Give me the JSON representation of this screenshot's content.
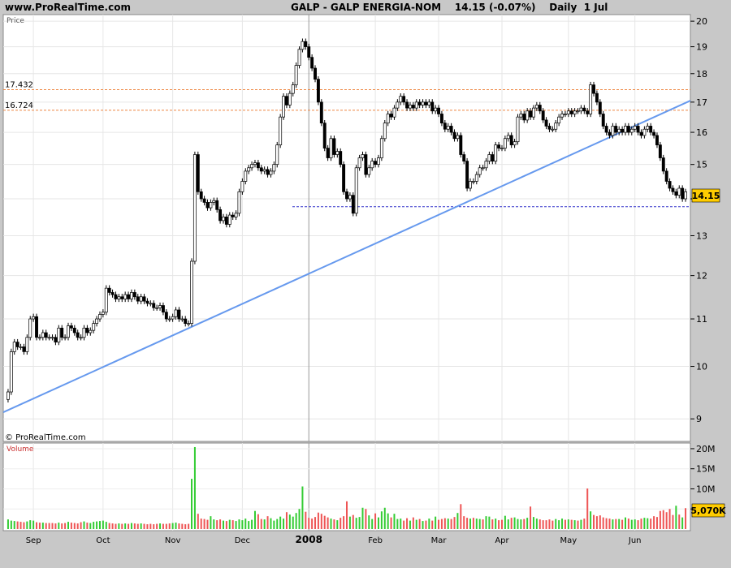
{
  "header": {
    "site": "www.ProRealTime.com",
    "title": "GALP - GALP ENERGIA-NOM    14.15 (-0.07%)    Daily  1 Jul"
  },
  "price_panel": {
    "label": "Price",
    "copyright": "© ProRealTime.com",
    "last_price_badge": "14.15"
  },
  "volume_panel": {
    "label": "Volume",
    "last_volume_badge": "5,070K"
  },
  "colors": {
    "background": "#c8c8c8",
    "panel": "#ffffff",
    "up_volume": "#33cc33",
    "down_volume": "#ee5555",
    "trendline": "#6699ee",
    "resistance": "#ee8844",
    "support": "#3333cc",
    "badge": "#ffcc00"
  },
  "chart_data": [
    {
      "type": "line",
      "title": "GALP - GALP ENERGIA-NOM",
      "ylabel": "Price",
      "ylim": [
        8.8,
        20.2
      ],
      "y_ticks": [
        9,
        10,
        11,
        12,
        13,
        14,
        15,
        16,
        17,
        18,
        19,
        20
      ],
      "x_ticks": [
        "Sep",
        "Oct",
        "Nov",
        "Dec",
        "2008",
        "Feb",
        "Mar",
        "Apr",
        "May",
        "Jun"
      ],
      "x_tick_index": [
        8,
        30,
        52,
        74,
        95,
        116,
        136,
        156,
        177,
        198
      ],
      "log_scale": true,
      "grid": true,
      "points": 215,
      "closes": [
        9.5,
        10.3,
        10.5,
        10.4,
        10.4,
        10.3,
        10.6,
        11.0,
        11.05,
        10.6,
        10.6,
        10.7,
        10.6,
        10.6,
        10.6,
        10.5,
        10.8,
        10.6,
        10.6,
        10.85,
        10.8,
        10.7,
        10.6,
        10.6,
        10.8,
        10.7,
        10.75,
        10.9,
        11.0,
        11.1,
        11.15,
        11.7,
        11.6,
        11.55,
        11.45,
        11.5,
        11.45,
        11.55,
        11.45,
        11.6,
        11.5,
        11.4,
        11.5,
        11.4,
        11.35,
        11.35,
        11.25,
        11.25,
        11.3,
        11.15,
        11.0,
        11.0,
        11.05,
        11.2,
        11.0,
        11.0,
        10.9,
        10.9,
        12.35,
        15.3,
        14.2,
        14.0,
        13.9,
        13.75,
        13.9,
        13.95,
        13.7,
        13.4,
        13.5,
        13.3,
        13.55,
        13.5,
        13.6,
        14.2,
        14.5,
        14.8,
        14.9,
        15.0,
        15.05,
        14.9,
        14.8,
        14.85,
        14.7,
        14.8,
        15.0,
        15.6,
        16.5,
        17.2,
        16.9,
        17.3,
        17.6,
        18.3,
        18.9,
        19.2,
        19.0,
        18.6,
        18.2,
        17.8,
        17.0,
        16.3,
        15.5,
        15.2,
        15.8,
        15.3,
        15.4,
        15.0,
        14.2,
        14.0,
        14.1,
        13.6,
        14.9,
        15.2,
        15.3,
        14.7,
        14.9,
        15.1,
        15.0,
        15.2,
        15.8,
        16.3,
        16.6,
        16.5,
        16.8,
        17.0,
        17.2,
        17.0,
        16.8,
        16.9,
        16.8,
        17.0,
        16.9,
        17.0,
        16.9,
        17.0,
        16.7,
        16.8,
        16.6,
        16.3,
        16.1,
        16.2,
        16.0,
        15.8,
        15.9,
        15.3,
        15.1,
        14.3,
        14.5,
        14.5,
        14.7,
        14.9,
        14.9,
        15.1,
        15.3,
        15.1,
        15.6,
        15.5,
        15.5,
        15.8,
        15.9,
        15.6,
        15.7,
        16.5,
        16.6,
        16.4,
        16.7,
        16.5,
        16.8,
        16.9,
        16.7,
        16.4,
        16.2,
        16.1,
        16.1,
        16.3,
        16.5,
        16.6,
        16.6,
        16.7,
        16.6,
        16.7,
        16.7,
        16.8,
        16.7,
        16.6,
        17.6,
        17.3,
        17.0,
        16.6,
        16.2,
        16.0,
        15.9,
        16.2,
        16.0,
        16.1,
        16.0,
        16.2,
        16.0,
        16.1,
        16.2,
        16.0,
        15.9,
        16.1,
        16.2,
        16.0,
        15.9,
        15.6,
        15.2,
        14.8,
        14.5,
        14.3,
        14.2,
        14.1,
        14.3,
        14.0,
        14.2
      ],
      "annotations": {
        "resistance_levels": [
          17.432,
          16.724
        ],
        "support_level": 13.78,
        "trendline": {
          "from_index": 0,
          "from_value": 9.12,
          "to_index": 215,
          "to_value": 17.05
        }
      }
    },
    {
      "type": "bar",
      "title": "Volume",
      "ylabel": "Volume",
      "ylim": [
        0,
        21000000
      ],
      "y_ticks": [
        "5M",
        "10M",
        "15M",
        "20M"
      ],
      "y_tick_values": [
        5000000,
        10000000,
        15000000,
        20000000
      ],
      "volumes_m": [
        2.4,
        2.1,
        2.0,
        1.9,
        1.8,
        1.7,
        1.9,
        2.2,
        2.1,
        1.7,
        1.6,
        1.6,
        1.5,
        1.5,
        1.5,
        1.4,
        1.6,
        1.4,
        1.5,
        1.8,
        1.6,
        1.5,
        1.4,
        1.7,
        1.9,
        1.6,
        1.5,
        1.8,
        1.9,
        2.0,
        2.1,
        1.8,
        1.5,
        1.4,
        1.3,
        1.4,
        1.3,
        1.4,
        1.3,
        1.5,
        1.4,
        1.3,
        1.4,
        1.3,
        1.2,
        1.3,
        1.2,
        1.3,
        1.4,
        1.3,
        1.3,
        1.4,
        1.5,
        1.6,
        1.4,
        1.3,
        1.2,
        1.3,
        12.5,
        20.4,
        3.8,
        2.6,
        2.5,
        2.3,
        3.2,
        2.4,
        2.2,
        2.4,
        2.1,
        2.0,
        2.3,
        2.2,
        2.0,
        2.4,
        2.2,
        2.6,
        2.0,
        2.3,
        4.5,
        3.7,
        2.5,
        2.4,
        3.2,
        2.7,
        2.1,
        2.5,
        3.1,
        2.6,
        4.2,
        3.6,
        3.1,
        4.0,
        5.0,
        10.6,
        4.3,
        2.8,
        2.6,
        3.0,
        4.1,
        3.8,
        3.3,
        2.9,
        2.6,
        2.4,
        2.2,
        2.8,
        3.2,
        6.9,
        3.1,
        3.5,
        2.8,
        3.0,
        5.3,
        5.0,
        3.4,
        2.5,
        3.9,
        2.9,
        4.4,
        5.3,
        3.9,
        2.9,
        3.8,
        2.5,
        2.6,
        2.1,
        2.7,
        2.1,
        2.9,
        2.3,
        2.5,
        2.0,
        2.1,
        2.6,
        2.1,
        3.1,
        2.3,
        2.5,
        2.7,
        2.6,
        2.5,
        3.0,
        4.0,
        6.2,
        3.2,
        2.8,
        2.6,
        2.8,
        2.6,
        2.5,
        2.4,
        3.2,
        3.1,
        2.4,
        2.6,
        2.2,
        2.3,
        3.3,
        2.4,
        2.8,
        2.9,
        2.5,
        2.4,
        2.5,
        2.8,
        5.6,
        3.0,
        2.6,
        2.4,
        2.2,
        2.2,
        2.4,
        2.1,
        2.5,
        2.2,
        2.6,
        2.3,
        2.4,
        2.3,
        2.2,
        2.1,
        2.3,
        2.6,
        10.1,
        4.4,
        3.5,
        3.2,
        3.4,
        2.9,
        2.7,
        2.6,
        2.4,
        2.5,
        2.5,
        2.3,
        2.9,
        2.6,
        2.3,
        2.4,
        2.2,
        2.6,
        2.8,
        2.7,
        2.6,
        3.2,
        3.0,
        4.5,
        4.7,
        4.2,
        5.0,
        3.5,
        5.8,
        3.6,
        2.9,
        5.2
      ],
      "up_flags": [
        1,
        1,
        1,
        0,
        0,
        0,
        1,
        1,
        1,
        0,
        0,
        1,
        0,
        0,
        0,
        0,
        1,
        0,
        0,
        1,
        0,
        0,
        0,
        0,
        1,
        0,
        1,
        1,
        1,
        1,
        1,
        1,
        0,
        0,
        0,
        1,
        0,
        1,
        0,
        1,
        0,
        0,
        1,
        0,
        0,
        0,
        0,
        0,
        1,
        0,
        0,
        0,
        1,
        1,
        0,
        0,
        0,
        0,
        1,
        1,
        0,
        0,
        0,
        0,
        1,
        1,
        0,
        0,
        1,
        0,
        1,
        0,
        1,
        1,
        1,
        1,
        1,
        1,
        1,
        0,
        0,
        1,
        0,
        1,
        1,
        1,
        1,
        1,
        0,
        1,
        1,
        1,
        1,
        1,
        0,
        0,
        0,
        0,
        0,
        0,
        0,
        0,
        1,
        0,
        1,
        0,
        0,
        0,
        1,
        0,
        1,
        1,
        1,
        0,
        1,
        1,
        0,
        1,
        1,
        1,
        1,
        0,
        1,
        1,
        1,
        0,
        0,
        1,
        0,
        1,
        0,
        1,
        0,
        1,
        0,
        1,
        0,
        0,
        0,
        1,
        0,
        0,
        1,
        0,
        0,
        0,
        1,
        0,
        1,
        1,
        0,
        1,
        1,
        0,
        1,
        0,
        0,
        1,
        1,
        0,
        1,
        1,
        1,
        0,
        1,
        0,
        1,
        1,
        0,
        0,
        0,
        0,
        0,
        1,
        1,
        1,
        0,
        1,
        0,
        1,
        0,
        1,
        0,
        0,
        1,
        0,
        0,
        0,
        0,
        0,
        0,
        1,
        0,
        1,
        0,
        1,
        0,
        1,
        1,
        0,
        0,
        1,
        1,
        0,
        0,
        0,
        0,
        0,
        0,
        0,
        0,
        1,
        0,
        1
      ]
    }
  ]
}
